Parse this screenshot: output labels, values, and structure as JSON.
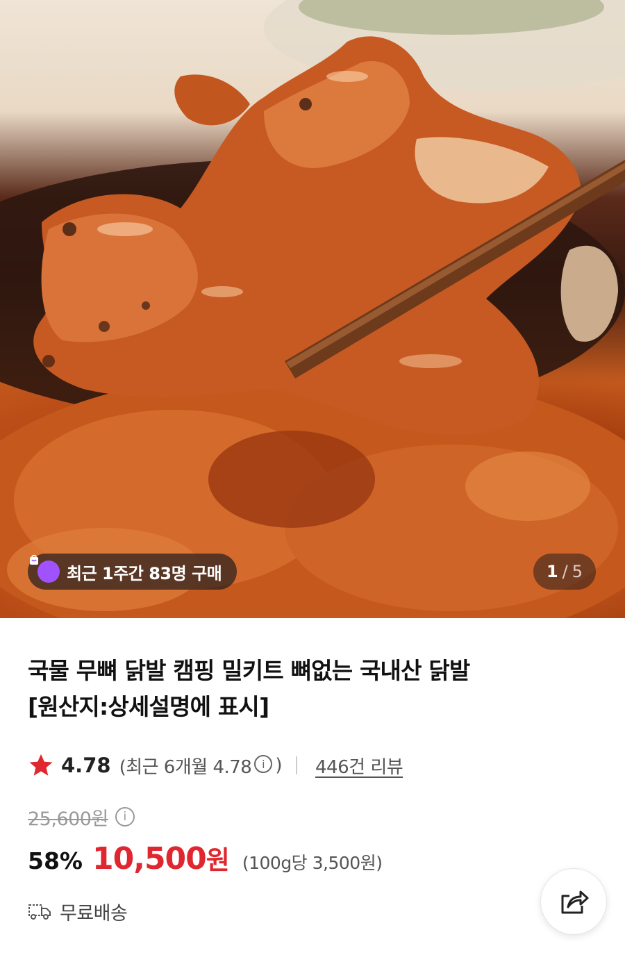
{
  "hero": {
    "badge_text": "최근 1주간 83명 구매",
    "counter": {
      "current": "1",
      "separator": "/",
      "total": "5"
    }
  },
  "product": {
    "title_line1": "국물 무뼈 닭발 캠핑 밀키트 뼈없는 국내산 닭발",
    "title_line2": "[원산지:상세설명에 표시]",
    "rating": {
      "value": "4.78",
      "recent_open": "(최근 6개월 4.78",
      "recent_close": ")",
      "review_count": "446건 리뷰",
      "star_color": "#e0262e"
    },
    "price": {
      "original": "25,600원",
      "discount": "58%",
      "sale_amount": "10,500",
      "sale_unit": "원",
      "unit_price": "(100g당 3,500원)",
      "accent_color": "#e0262e"
    },
    "shipping": {
      "label": "무료배송",
      "icon": "truck-icon"
    }
  },
  "icons": {
    "info": "i",
    "badge_icon": "shopping-bag-icon",
    "share_icon": "share-icon"
  }
}
